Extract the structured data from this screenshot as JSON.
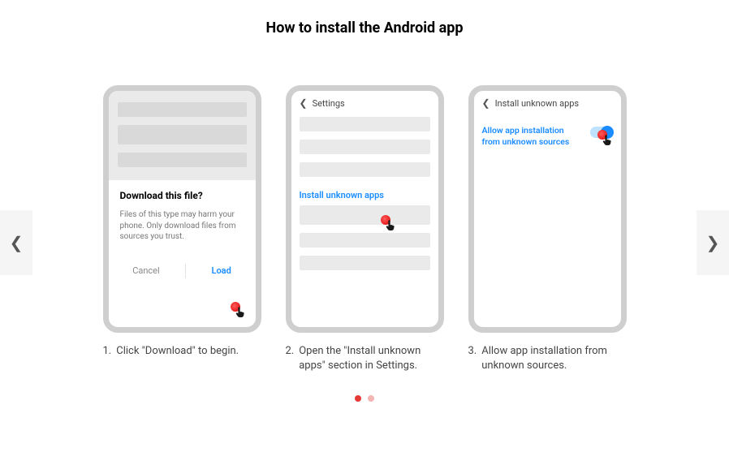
{
  "title": "How to install the Android app",
  "steps": [
    {
      "num": "1.",
      "caption": "Click \"Download\" to begin.",
      "dialog_title": "Download this file?",
      "dialog_body": "Files of this type may harm your phone. Only download files from sources you trust.",
      "cancel": "Cancel",
      "load": "Load"
    },
    {
      "num": "2.",
      "caption": "Open the \"Install unknown apps\" section in Settings.",
      "header": "Settings",
      "link": "Install unknown apps"
    },
    {
      "num": "3.",
      "caption": "Allow app installation from unknown sources.",
      "header": "Install unknown apps",
      "toggle_label": "Allow app installation from unknown sources"
    }
  ],
  "pagination": {
    "active": 0,
    "total": 2
  }
}
